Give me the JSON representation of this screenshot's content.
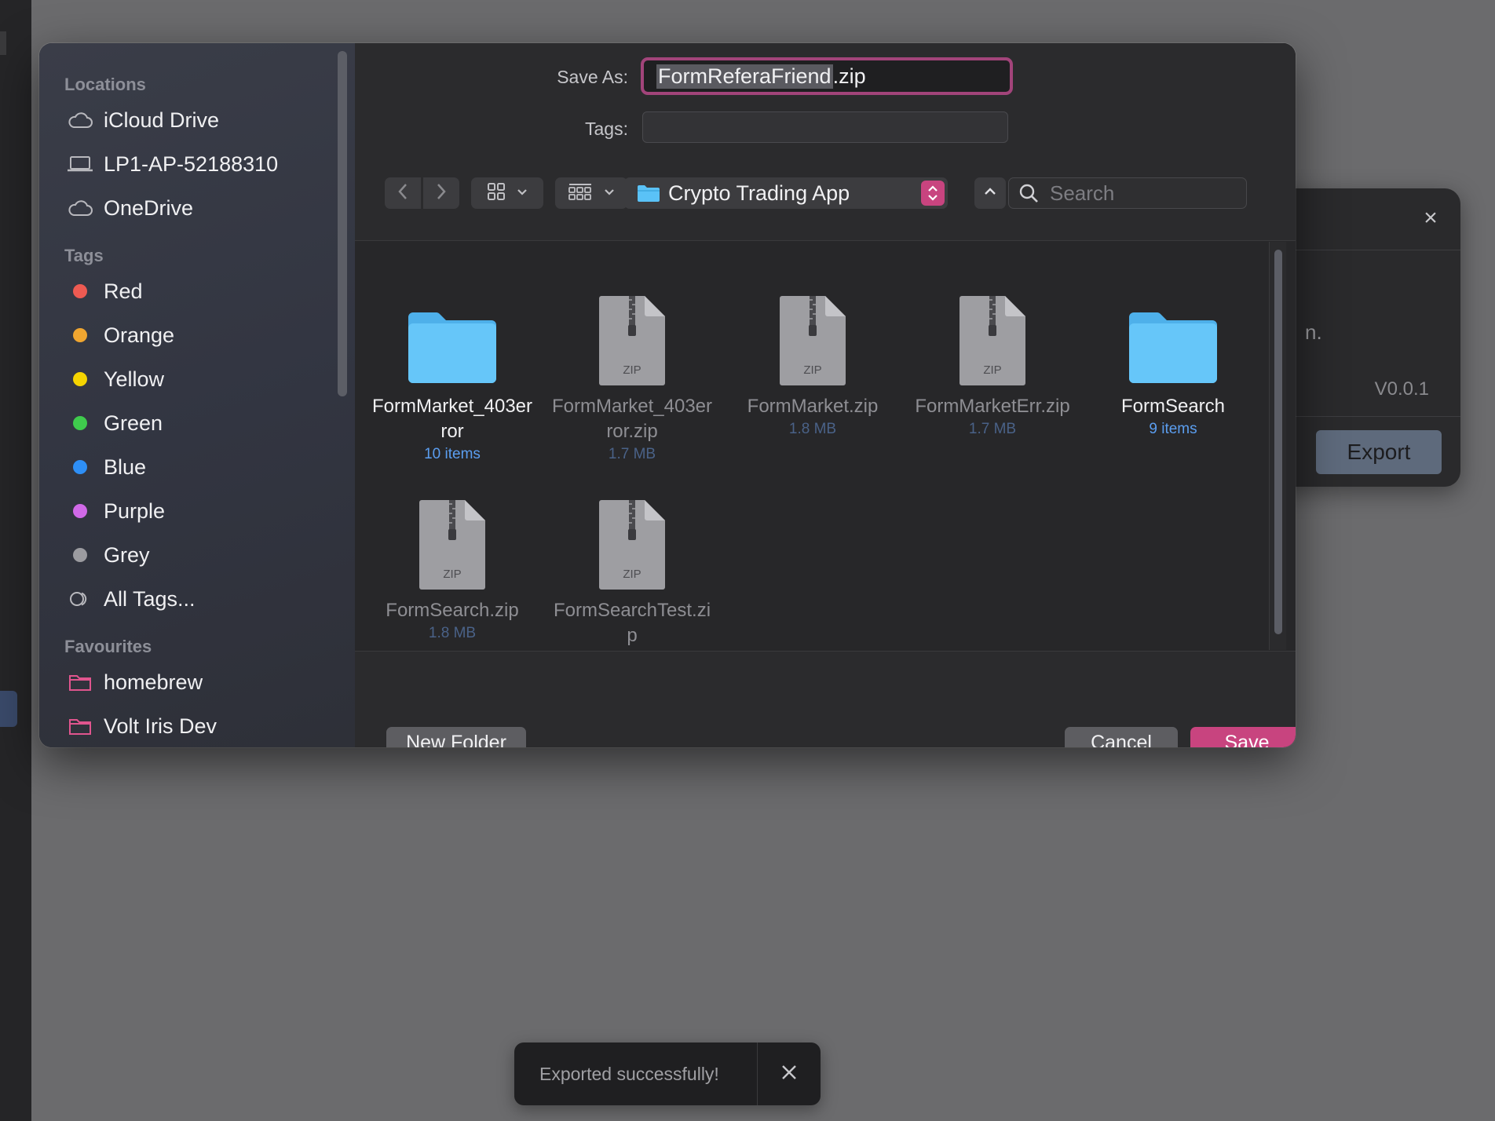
{
  "dialog": {
    "save_as_label": "Save As:",
    "filename_selected": "FormReferaFriend",
    "filename_ext": ".zip",
    "tags_label": "Tags:"
  },
  "toolbar": {
    "path": "Crypto Trading App",
    "search_placeholder": "Search"
  },
  "sidebar": {
    "locations_header": "Locations",
    "locations": [
      {
        "label": "iCloud Drive",
        "icon": "cloud-icon"
      },
      {
        "label": "LP1-AP-52188310",
        "icon": "laptop-icon"
      },
      {
        "label": "OneDrive",
        "icon": "cloud-icon"
      }
    ],
    "tags_header": "Tags",
    "tags": [
      {
        "label": "Red",
        "color": "#ee5a52"
      },
      {
        "label": "Orange",
        "color": "#f0a630"
      },
      {
        "label": "Yellow",
        "color": "#f5d400"
      },
      {
        "label": "Green",
        "color": "#3fcb4d"
      },
      {
        "label": "Blue",
        "color": "#2e8ff6"
      },
      {
        "label": "Purple",
        "color": "#d169e8"
      },
      {
        "label": "Grey",
        "color": "#9b9ba0"
      }
    ],
    "all_tags": "All Tags...",
    "favourites_header": "Favourites",
    "favourites": [
      {
        "label": "homebrew"
      },
      {
        "label": "Volt Iris Dev"
      }
    ]
  },
  "files": [
    {
      "name": "FormMarket_403error",
      "meta": "10 items",
      "kind": "folder",
      "dim": false
    },
    {
      "name": "FormMarket_403error.zip",
      "meta": "1.7 MB",
      "kind": "zip",
      "dim": true
    },
    {
      "name": "FormMarket.zip",
      "meta": "1.8 MB",
      "kind": "zip",
      "dim": true
    },
    {
      "name": "FormMarketErr.zip",
      "meta": "1.7 MB",
      "kind": "zip",
      "dim": true
    },
    {
      "name": "FormSearch",
      "meta": "9 items",
      "kind": "folder",
      "dim": false
    },
    {
      "name": "FormSearch.zip",
      "meta": "1.8 MB",
      "kind": "zip",
      "dim": true
    },
    {
      "name": "FormSearchTest.zip",
      "meta": "",
      "kind": "zip",
      "dim": true
    }
  ],
  "zip_badge": "ZIP",
  "buttons": {
    "new_folder": "New Folder",
    "cancel": "Cancel",
    "save": "Save"
  },
  "background": {
    "fragment": "n.",
    "version": "V0.0.1",
    "export": "Export"
  },
  "toast": {
    "message": "Exported successfully!"
  },
  "colors": {
    "accent": "#c8447f",
    "folder": "#5ac2f7"
  }
}
